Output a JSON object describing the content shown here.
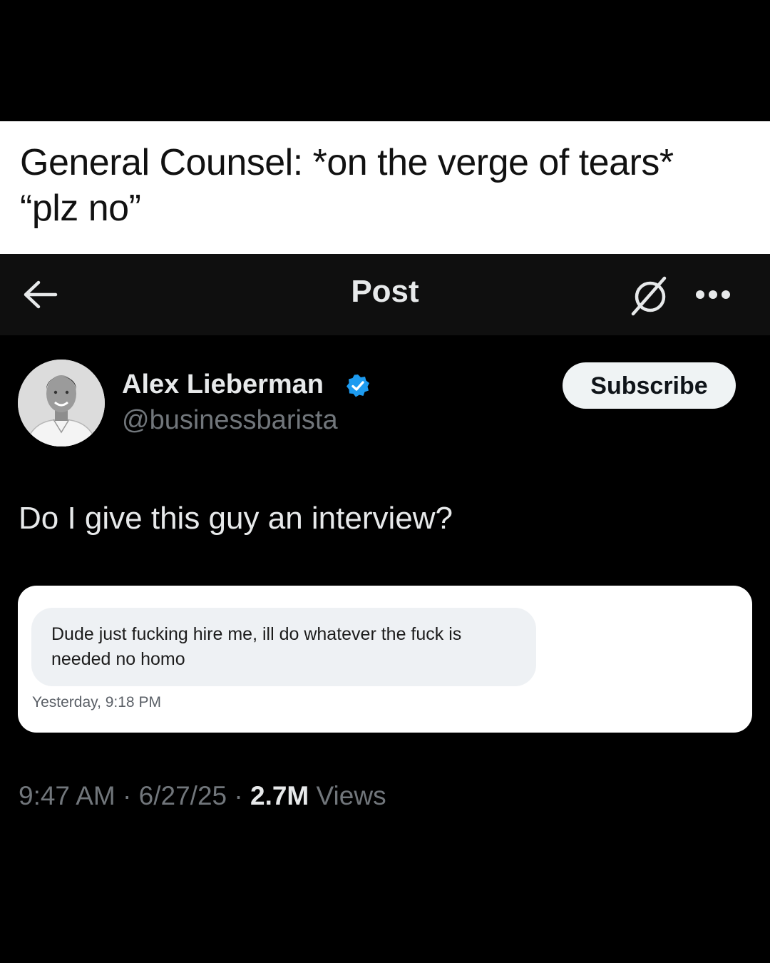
{
  "caption": {
    "line1": "General Counsel: *on the verge of tears*",
    "line2": "“plz no”"
  },
  "topbar": {
    "back_icon": "arrow-left-icon",
    "title": "Post",
    "grok_icon": "grok-icon",
    "more_icon": "more-horizontal-icon"
  },
  "author": {
    "name": "Alex Lieberman",
    "handle": "@businessbarista",
    "verified_icon": "verified-badge-icon",
    "verified_color": "#1d9bf0"
  },
  "subscribe_label": "Subscribe",
  "post": {
    "text": "Do I give this guy an interview?"
  },
  "embedded_message": {
    "text": "Dude just fucking hire me, ill do whatever the fuck is needed no homo",
    "timestamp": "Yesterday, 9:18 PM"
  },
  "meta": {
    "time": "9:47 AM",
    "date": "6/27/25",
    "views_count": "2.7M",
    "views_label": "Views",
    "separator": "·"
  },
  "colors": {
    "background": "#000000",
    "topbar": "#0f0f0f",
    "primary_text": "#e7e9ea",
    "secondary_text": "#71767b"
  }
}
